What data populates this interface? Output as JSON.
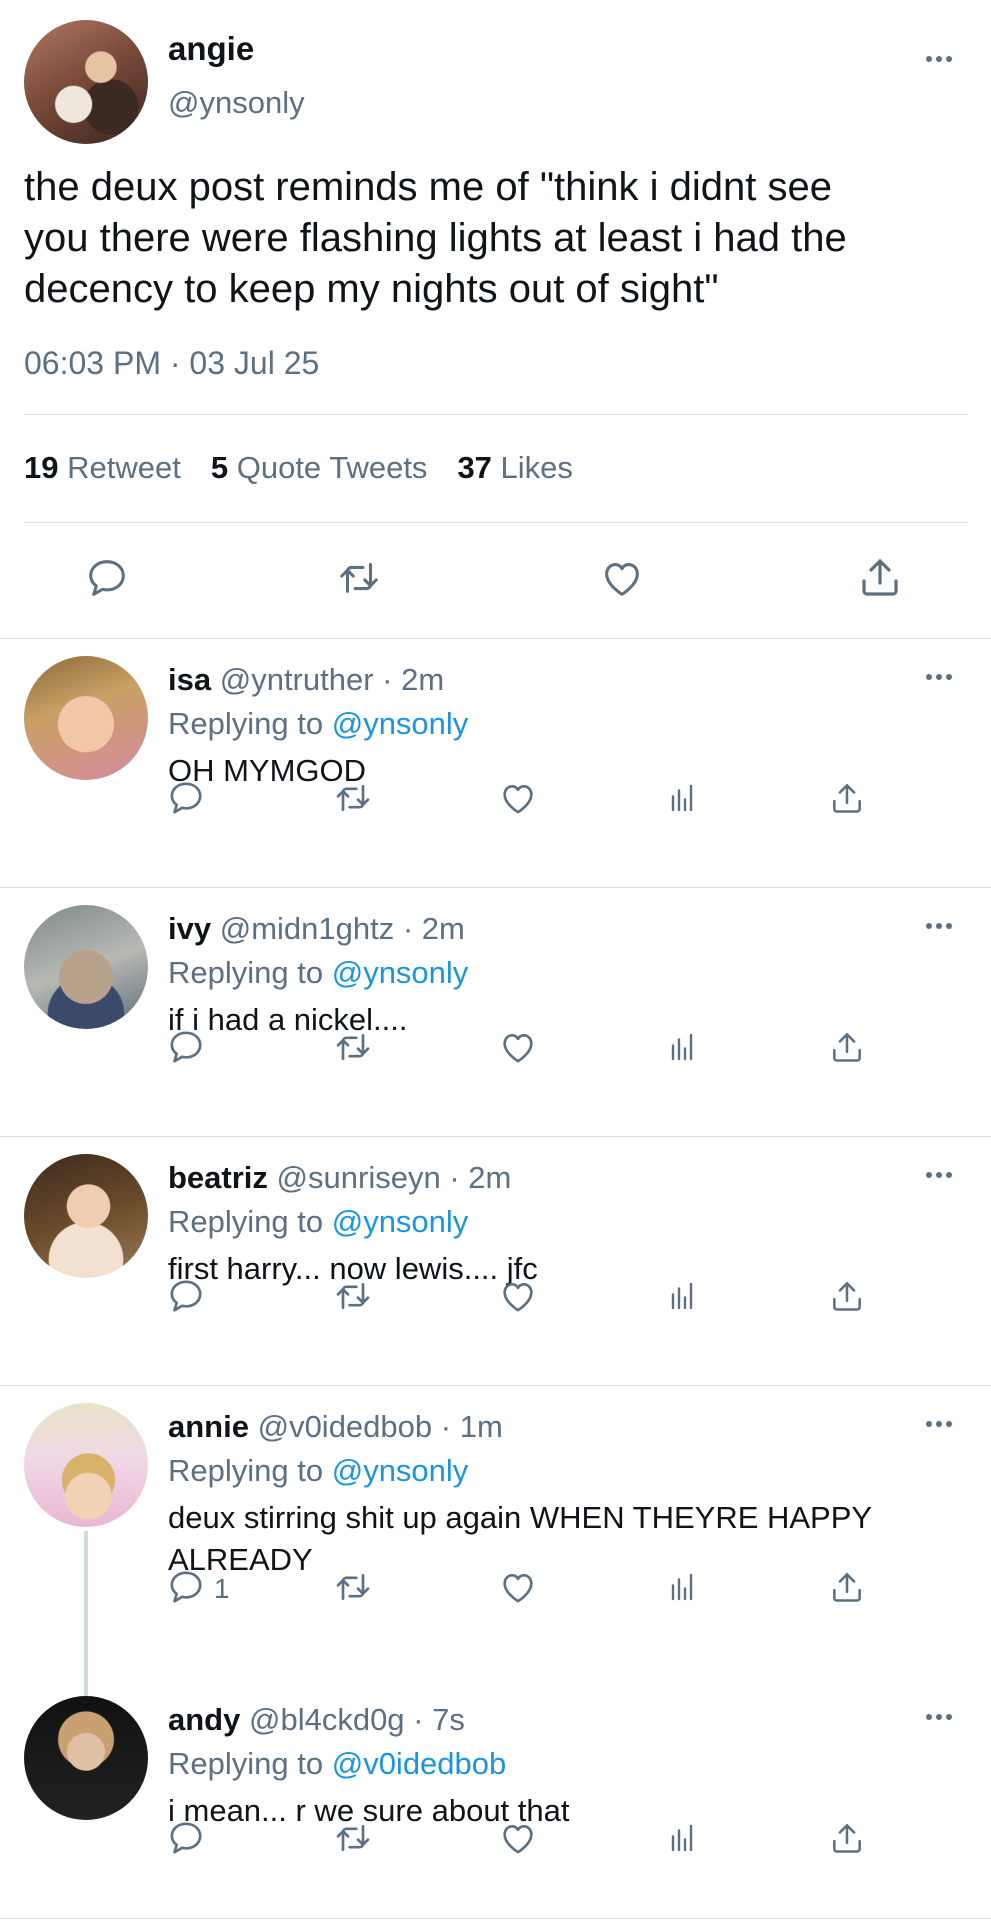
{
  "main": {
    "name": "angie",
    "handle": "@ynsonly",
    "text": "the deux post reminds me of \"think i didnt see\nyou there were flashing lights at least i had the\ndecency to keep my nights out of sight\"",
    "timestamp": "06:03 PM · 03 Jul 25",
    "stats": [
      {
        "count": "19",
        "label": "Retweet"
      },
      {
        "count": "5",
        "label": "Quote Tweets"
      },
      {
        "count": "37",
        "label": "Likes"
      }
    ]
  },
  "replies": [
    {
      "name": "isa",
      "handle": "@yntruther",
      "time": "· 2m",
      "replying_label": "Replying to",
      "replying_to": "@ynsonly",
      "text": "OH MYMGOD",
      "reply_count": ""
    },
    {
      "name": "ivy",
      "handle": "@midn1ghtz",
      "time": "· 2m",
      "replying_label": "Replying to",
      "replying_to": "@ynsonly",
      "text": "if i had a nickel....",
      "reply_count": ""
    },
    {
      "name": "beatriz",
      "handle": "@sunriseyn",
      "time": "· 2m",
      "replying_label": "Replying to",
      "replying_to": "@ynsonly",
      "text": "first harry... now lewis.... jfc",
      "reply_count": ""
    },
    {
      "name": "annie",
      "handle": "@v0idedbob",
      "time": "· 1m",
      "replying_label": "Replying to",
      "replying_to": "@ynsonly",
      "text": "deux stirring shit up again WHEN THEYRE HAPPY ALREADY",
      "reply_count": "1"
    },
    {
      "name": "andy",
      "handle": "@bl4ckd0g",
      "time": "· 7s",
      "replying_label": "Replying to",
      "replying_to": "@v0idedbob",
      "text": "i mean... r we sure about that",
      "reply_count": ""
    }
  ],
  "icons": {
    "reply": "comment-bubble-icon",
    "retweet": "retweet-icon",
    "like": "heart-icon",
    "analytics": "analytics-bars-icon",
    "share": "share-upload-icon",
    "more": "more-dots-icon"
  },
  "colors": {
    "text": "#0f1419",
    "secondary": "#5b7083",
    "link": "#1b95e0",
    "divider": "#d9dfe3",
    "icon": "#5b7083"
  }
}
